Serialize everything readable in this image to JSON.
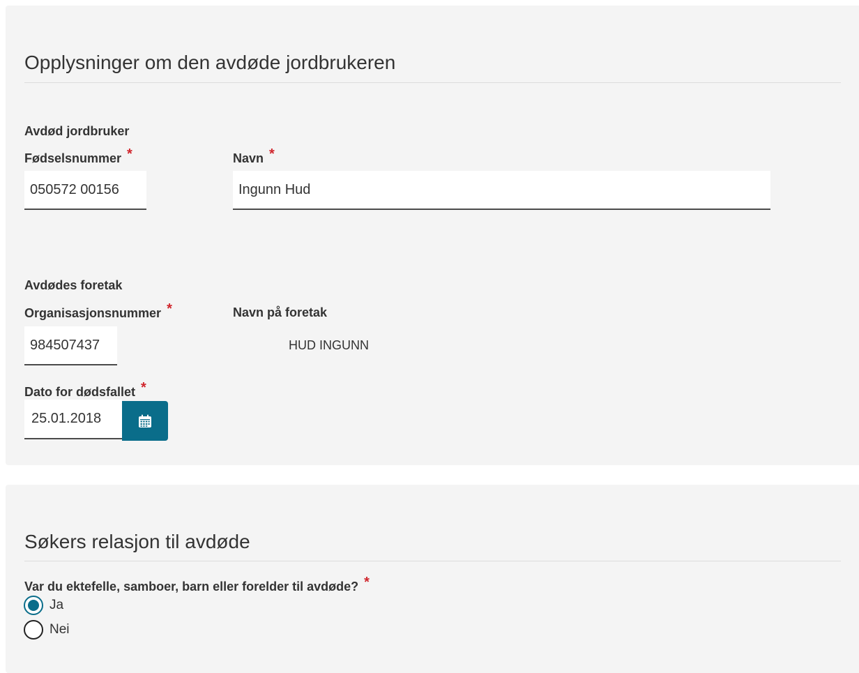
{
  "section1": {
    "title": "Opplysninger om den avdøde jordbrukeren",
    "deceased_farmer": {
      "group_label": "Avdød jordbruker",
      "ssn_label": "Fødselsnummer",
      "ssn_value": "050572 00156",
      "name_label": "Navn",
      "name_value": "Ingunn Hud"
    },
    "company": {
      "group_label": "Avdødes foretak",
      "org_label": "Organisasjonsnummer",
      "org_value": "984507437",
      "company_name_label": "Navn på foretak",
      "company_name_value": "HUD INGUNN"
    },
    "date_of_death": {
      "label": "Dato for dødsfallet",
      "value": "25.01.2018",
      "button_icon": "calendar-icon"
    },
    "required_marker": "*"
  },
  "section2": {
    "title": "Søkers relasjon til avdøde",
    "question": "Var du ektefelle, samboer, barn eller forelder til avdøde?",
    "options": [
      {
        "label": "Ja",
        "checked": true
      },
      {
        "label": "Nei",
        "checked": false
      }
    ]
  },
  "colors": {
    "accent": "#0a6d8a",
    "required": "#d0262d",
    "panel_bg": "#f4f4f4"
  }
}
